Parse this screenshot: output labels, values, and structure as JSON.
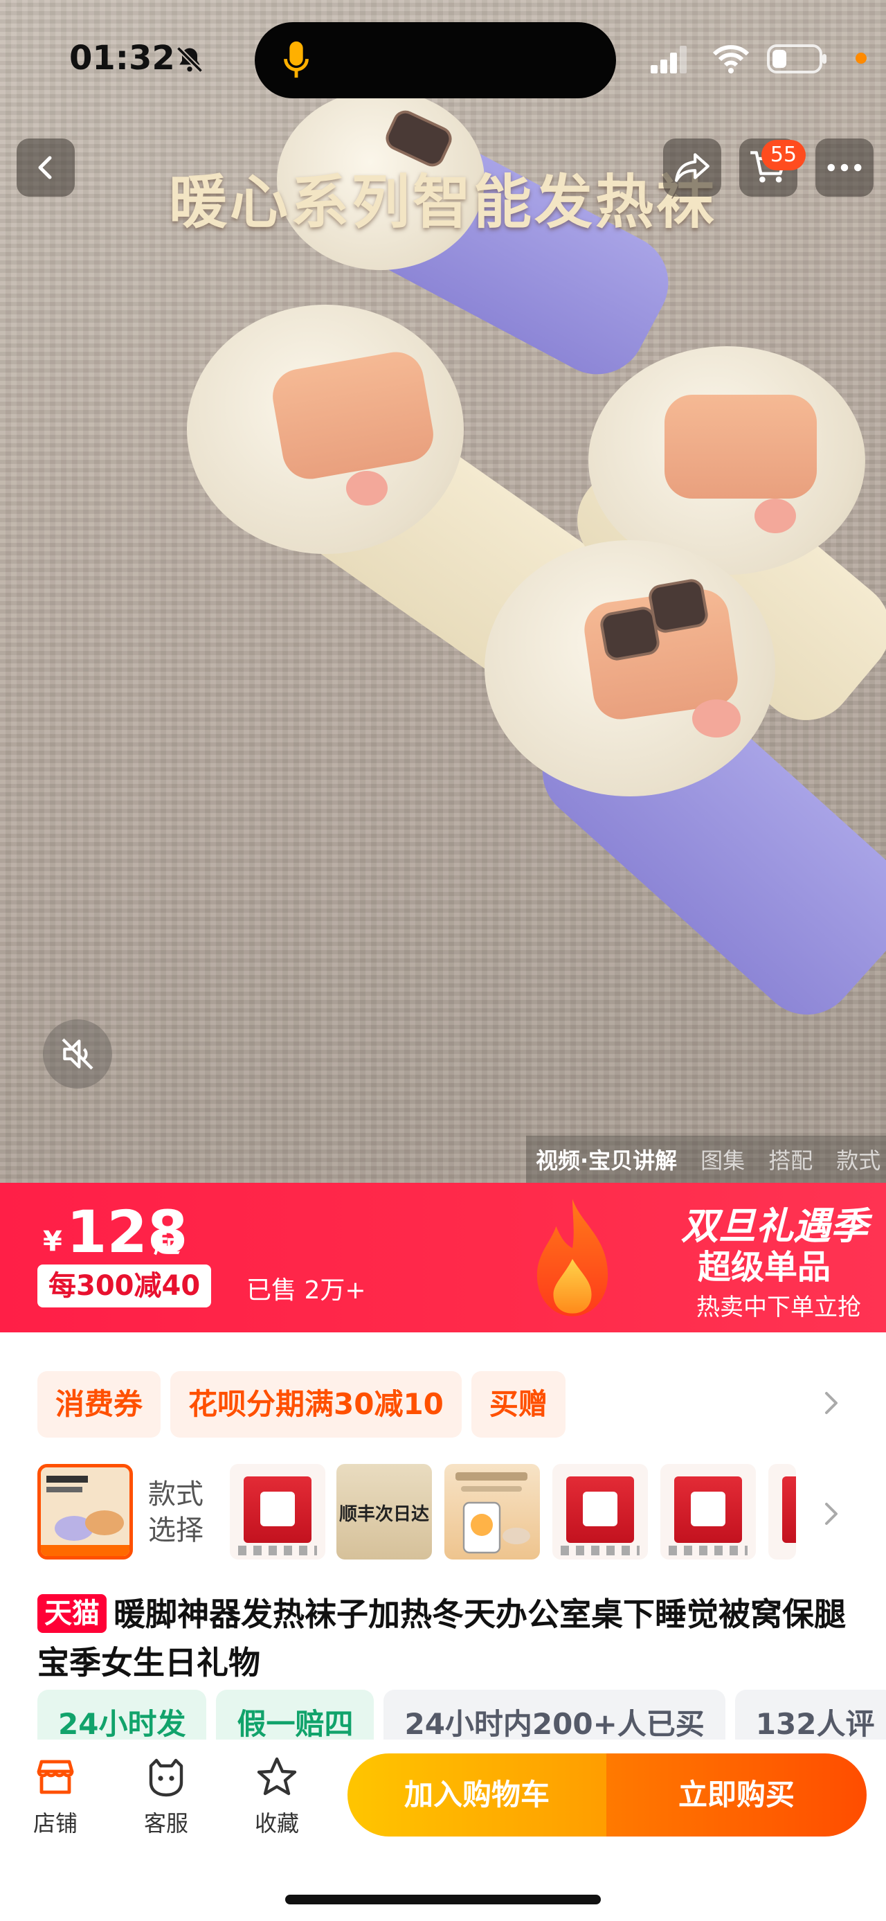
{
  "status_bar": {
    "time": "01:32"
  },
  "hero": {
    "title": "暖心系列智能发热袜",
    "cart_badge": "55",
    "media_tabs": [
      "视频·宝贝讲解",
      "图集",
      "搭配",
      "款式"
    ]
  },
  "price_banner": {
    "currency": "¥",
    "price": "128",
    "suffix": "起",
    "discount": "每300减40",
    "sold": "已售 2万+",
    "promo_title_1": "双旦礼遇季",
    "promo_title_2": "超级单品",
    "promo_sub": "热卖中下单立抢"
  },
  "coupons": [
    "消费券",
    "花呗分期满30减10",
    "买赠"
  ],
  "style_select": {
    "label": "款式选择",
    "sf_text": "顺丰次日达"
  },
  "product": {
    "badge": "天猫",
    "title": "暖脚神器发热袜子加热冬天办公室桌下睡觉被窝保腿宝季女生日礼物"
  },
  "service_tags": [
    "24小时发",
    "假一赔四",
    "24小时内200+人已买",
    "132人评"
  ],
  "bottom_bar": {
    "store": "店铺",
    "service": "客服",
    "favorite": "收藏",
    "add_cart": "加入购物车",
    "buy_now": "立即购买"
  },
  "colors": {
    "brand_orange": "#ff5000",
    "banner_red": "#ff1f47",
    "tmall_red": "#ff0036"
  }
}
